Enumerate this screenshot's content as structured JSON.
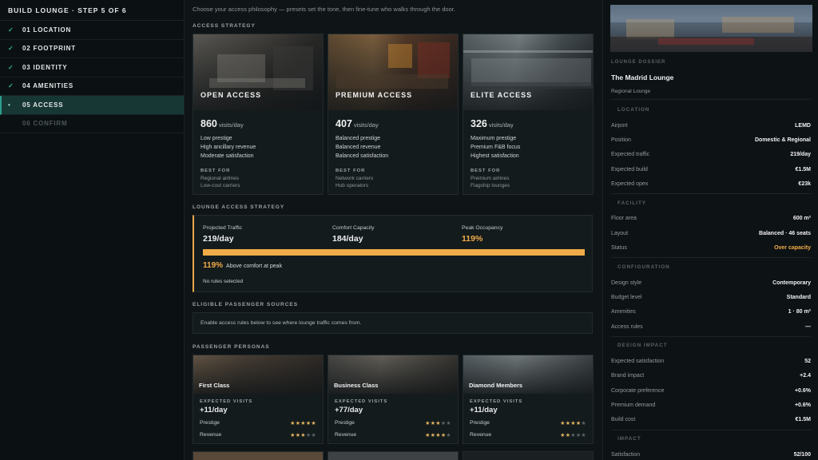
{
  "sidebar": {
    "title": "BUILD LOUNGE · STEP 5 OF 6",
    "items": [
      {
        "marker": "✓",
        "label": "01 LOCATION"
      },
      {
        "marker": "✓",
        "label": "02 FOOTPRINT"
      },
      {
        "marker": "✓",
        "label": "03 IDENTITY"
      },
      {
        "marker": "✓",
        "label": "04 AMENITIES"
      },
      {
        "marker": "•",
        "label": "05 ACCESS"
      },
      {
        "marker": "",
        "label": "06 CONFIRM"
      }
    ]
  },
  "main": {
    "intro": "Choose your access philosophy — presets set the tone, then fine-tune who walks through the door.",
    "access_strategy_label": "ACCESS STRATEGY",
    "best_for_label": "BEST FOR",
    "visits_unit": "visits/day",
    "cards": [
      {
        "title": "OPEN ACCESS",
        "visits": "860",
        "features": [
          "Low prestige",
          "High ancillary revenue",
          "Moderate satisfaction"
        ],
        "best": [
          "Regional airlines",
          "Low-cost carriers"
        ]
      },
      {
        "title": "PREMIUM ACCESS",
        "visits": "407",
        "features": [
          "Balanced prestige",
          "Balanced revenue",
          "Balanced satisfaction"
        ],
        "best": [
          "Network carriers",
          "Hub operators"
        ]
      },
      {
        "title": "ELITE ACCESS",
        "visits": "326",
        "features": [
          "Maximum prestige",
          "Premium F&B focus",
          "Highest satisfaction"
        ],
        "best": [
          "Premium airlines",
          "Flagship lounges"
        ]
      }
    ],
    "strategy": {
      "section_label": "LOUNGE ACCESS STRATEGY",
      "projected_label": "Projected Traffic",
      "projected_value": "219/day",
      "comfort_label": "Comfort Capacity",
      "comfort_value": "184/day",
      "peak_label": "Peak Occupancy",
      "peak_value": "119%",
      "occupancy_fraction": 1.0,
      "warning_pct": "119%",
      "warning_text": "Above comfort at peak",
      "rules_text": "No rules selected"
    },
    "eligible": {
      "section_label": "ELIGIBLE PASSENGER SOURCES",
      "text": "Enable access rules below to see where lounge traffic comes from."
    },
    "personas": {
      "section_label": "PASSENGER PERSONAS",
      "expected_label": "EXPECTED VISITS",
      "prestige_label": "Prestige",
      "revenue_label": "Revenue",
      "items": [
        {
          "name": "First Class",
          "visits": "+11/day",
          "prestige": 5,
          "revenue": 3
        },
        {
          "name": "Business Class",
          "visits": "+77/day",
          "prestige": 3,
          "revenue": 4
        },
        {
          "name": "Diamond Members",
          "visits": "+11/day",
          "prestige": 4,
          "revenue": 2
        }
      ]
    }
  },
  "dossier": {
    "label": "LOUNGE DOSSIER",
    "name": "The Madrid Lounge",
    "subtitle": "Regional Lounge",
    "location_label": "LOCATION",
    "facility_label": "FACILITY",
    "configuration_label": "CONFIGURATION",
    "design_impact_label": "DESIGN IMPACT",
    "impact_label": "IMPACT",
    "location": [
      {
        "k": "Airport",
        "v": "LEMD"
      },
      {
        "k": "Position",
        "v": "Domestic & Regional"
      },
      {
        "k": "Expected traffic",
        "v": "219/day"
      },
      {
        "k": "Expected build",
        "v": "€1.5M"
      },
      {
        "k": "Expected opex",
        "v": "€23k"
      }
    ],
    "facility": [
      {
        "k": "Floor area",
        "v": "600 m²"
      },
      {
        "k": "Layout",
        "v": "Balanced · 46 seats"
      },
      {
        "k": "Status",
        "v": "Over capacity"
      }
    ],
    "configuration": [
      {
        "k": "Design style",
        "v": "Contemporary"
      },
      {
        "k": "Budget level",
        "v": "Standard"
      },
      {
        "k": "Amenities",
        "v": "1 · 80 m²"
      },
      {
        "k": "Access rules",
        "v": "—"
      }
    ],
    "design_impact": [
      {
        "k": "Expected satisfaction",
        "v": "52"
      },
      {
        "k": "Brand impact",
        "v": "+2.4"
      },
      {
        "k": "Corporate preference",
        "v": "+0.6%"
      },
      {
        "k": "Premium demand",
        "v": "+0.6%"
      },
      {
        "k": "Build cost",
        "v": "€1.5M"
      }
    ],
    "impact": [
      {
        "k": "Satisfaction",
        "v": "52/100"
      }
    ]
  },
  "colors": {
    "accent_teal": "#2c9f8c",
    "warning_orange": "#f0ac48",
    "check_green": "#39b59a"
  }
}
